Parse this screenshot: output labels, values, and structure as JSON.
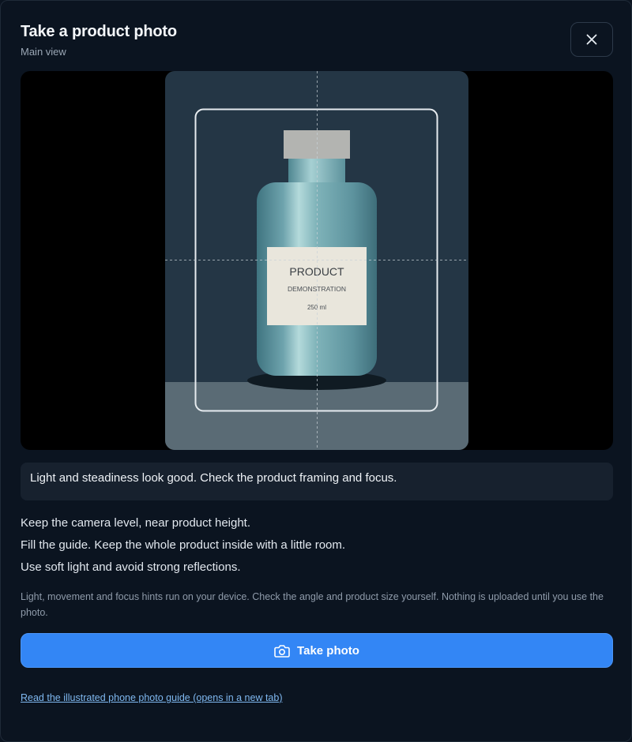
{
  "header": {
    "title": "Take a product photo",
    "subtitle": "Main view",
    "close_icon": "close-icon"
  },
  "viewfinder": {
    "product_label": {
      "name": "PRODUCT",
      "description": "DEMONSTRATION",
      "volume": "250 ml"
    }
  },
  "status": {
    "message": "Light and steadiness look good. Check the product framing and focus."
  },
  "tips": [
    "Keep the camera level, near product height.",
    "Fill the guide. Keep the whole product inside with a little room.",
    "Use soft light and avoid strong reflections."
  ],
  "privacy_note": "Light, movement and focus hints run on your device. Check the angle and product size yourself. Nothing is uploaded until you use the photo.",
  "actions": {
    "take_photo_label": "Take photo",
    "take_photo_icon": "camera-icon",
    "guide_link_label": "Read the illustrated phone photo guide (opens in a new tab)"
  },
  "colors": {
    "primary": "#3386f5",
    "background": "#0b1420",
    "link": "#7fb8f0"
  }
}
